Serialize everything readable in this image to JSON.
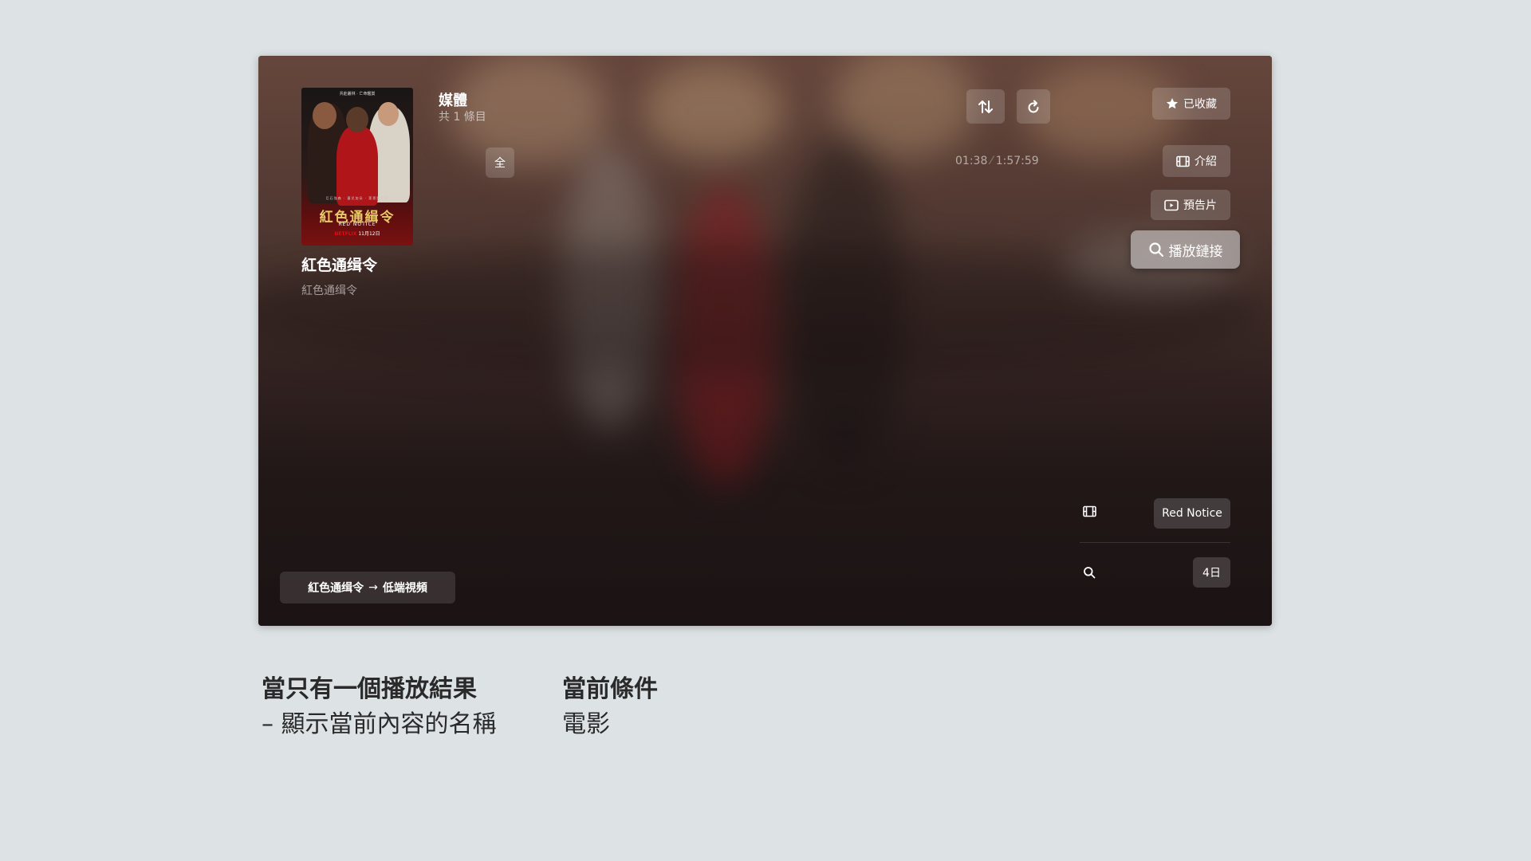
{
  "header": {
    "media_label": "媒體",
    "media_count": "共 1 條目"
  },
  "toolbar": {
    "sort_icon": "sort-arrows-icon",
    "refresh_icon": "refresh-icon",
    "all_label": "全"
  },
  "item": {
    "title": "紅色通缉令",
    "subtitle": "紅色通缉令",
    "poster": {
      "tagline": "共赴叢林 · 亡命鑑賞",
      "cast": "巨石強森 · 蓋兒加朵 · 萊恩雷諾斯",
      "title_cn": "紅色通緝令",
      "title_en": "RED NOTICE",
      "brand": "NETFLIX",
      "date": "11月12日"
    }
  },
  "playback": {
    "position": "01:38",
    "duration": "1:57:59",
    "separator": "⁄"
  },
  "actions": {
    "favorite_label": "已收藏",
    "intro_label": "介紹",
    "trailer_label": "預告片",
    "play_link_label": "播放鏈接"
  },
  "details": {
    "original_name": "Red Notice",
    "date_label": "4日"
  },
  "path": {
    "from": "紅色通缉令",
    "arrow": "→",
    "to": "低端視頻"
  },
  "captions": {
    "left_title": "當只有一個播放結果",
    "left_sub": "– 顯示當前內容的名稱",
    "right_title": "當前條件",
    "right_sub": "電影"
  },
  "colors": {
    "page_bg": "#dde3e5",
    "panel_bg": "#3a2826",
    "poster_accent": "#e7c869",
    "brand_red": "#e50914"
  }
}
